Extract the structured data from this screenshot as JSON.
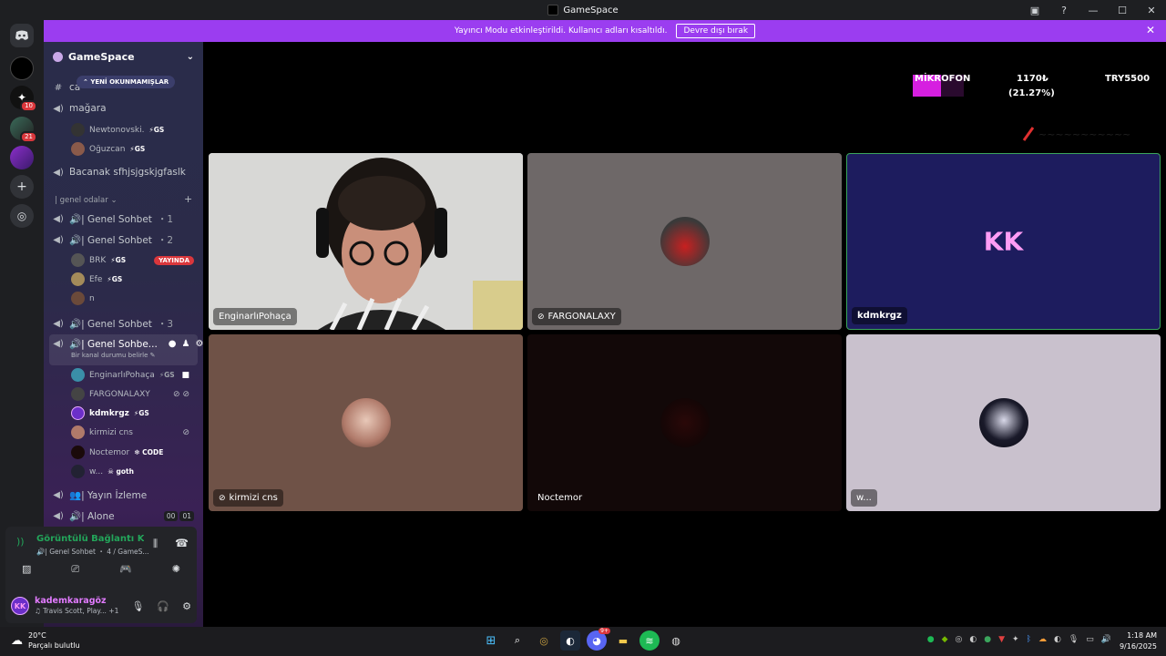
{
  "window": {
    "title": "GameSpace"
  },
  "banner": {
    "text": "Yayıncı Modu etkinleştirildi. Kullanıcı adları kısaltıldı.",
    "button": "Devre dışı bırak"
  },
  "server_rail": {
    "badges": [
      "10",
      "21"
    ]
  },
  "sidebar": {
    "server_name": "GameSpace",
    "new_unreads": "YENİ OKUNMAMIŞLAR",
    "partial_channel": "ca",
    "channel_magara": "mağara",
    "magara_users": [
      {
        "name": "Newtonovski.",
        "tag": "GS"
      },
      {
        "name": "Oğuzcan",
        "tag": "GS"
      }
    ],
    "channel_bacanak": "Bacanak sfhjsjgskjgfaslk",
    "category": "| genel odalar",
    "channels": [
      {
        "name": "🔊| Genel Sohbet",
        "num": "1"
      },
      {
        "name": "🔊| Genel Sohbet",
        "num": "2"
      },
      {
        "name": "🔊| Genel Sohbet",
        "num": "3"
      }
    ],
    "sohbet2_users": [
      {
        "name": "BRK",
        "tag": "GS",
        "live": "YAYINDA"
      },
      {
        "name": "Efe",
        "tag": "GS"
      },
      {
        "name": "n"
      }
    ],
    "active_channel": {
      "name": "🔊| Genel Sohbe...",
      "status": "Bir kanal durumu belirle"
    },
    "active_users": [
      {
        "name": "EnginarlıPohaça",
        "tag": "GS"
      },
      {
        "name": "FARGONALAXY"
      },
      {
        "name": "kdmkrgz",
        "tag": "GS"
      },
      {
        "name": "kirmizi cns"
      },
      {
        "name": "Noctemor",
        "tag": "CODE"
      },
      {
        "name": "w...",
        "tag": "goth"
      }
    ],
    "yayin": "👥| Yayın İzleme",
    "alone": "🔊| Alone",
    "alone_counts": [
      "00",
      "01"
    ]
  },
  "voice": {
    "status": "Görüntülü Bağlantı Kuruldu",
    "sub": "🔊| Genel Sohbet",
    "sub2": "4 / GameS..."
  },
  "user": {
    "initials": "KK",
    "name": "kademkaragöz",
    "activity": "Travis Scott, Play...",
    "extra": "+1"
  },
  "overlay": {
    "mic": "MİKROFON",
    "price": "1170₺",
    "pct": "(21.27%)",
    "target": "TRY5500",
    "mic_level": 0.56
  },
  "tiles": [
    {
      "name": "EnginarlıPohaça"
    },
    {
      "name": "FARGONALAXY"
    },
    {
      "name": "kdmkrgz",
      "initials": "KK"
    },
    {
      "name": "kirmizi cns"
    },
    {
      "name": "Noctemor"
    },
    {
      "name": "w..."
    }
  ],
  "taskbar": {
    "temp": "20°C",
    "weather": "Parçalı bulutlu",
    "time": "1:18 AM",
    "date": "9/16/2025",
    "discord_badge": "9+"
  }
}
